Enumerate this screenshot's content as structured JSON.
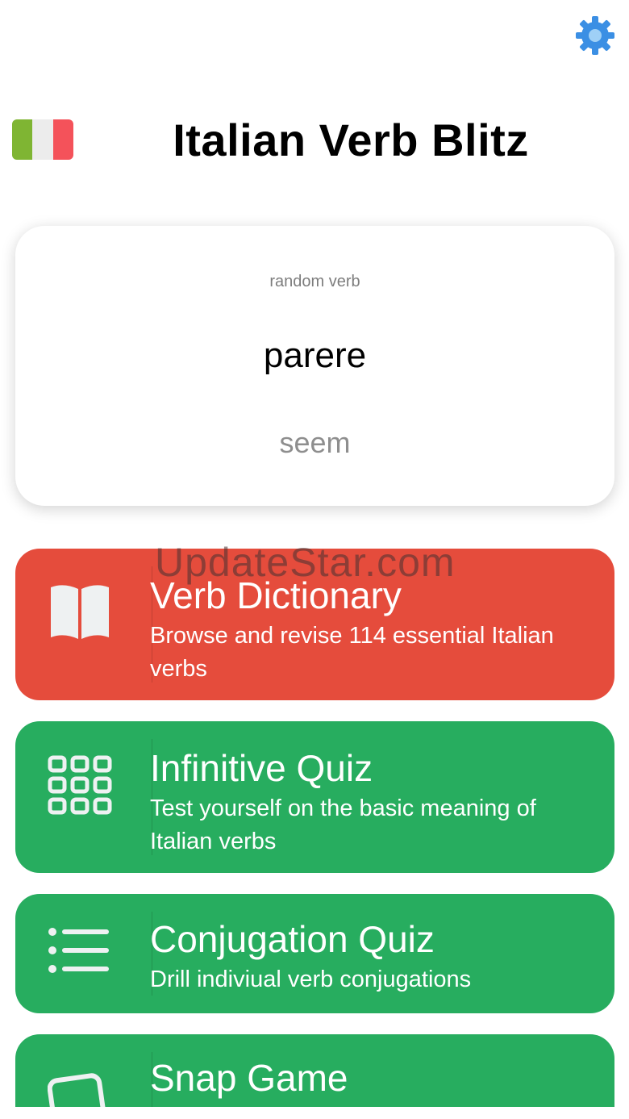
{
  "header": {
    "title": "Italian Verb Blitz",
    "flag_colors": [
      "#7fb533",
      "#ececec",
      "#f4525a"
    ],
    "settings_icon": "gear-icon"
  },
  "verb_card": {
    "label": "random verb",
    "verb": "parere",
    "translation": "seem"
  },
  "menu": {
    "items": [
      {
        "title": "Verb Dictionary",
        "description": "Browse and revise 114 essential Italian verbs",
        "icon": "book-icon",
        "color": "#e54c3c"
      },
      {
        "title": "Infinitive Quiz",
        "description": "Test yourself on the basic meaning of Italian verbs",
        "icon": "grid-icon",
        "color": "#27ad5f"
      },
      {
        "title": "Conjugation Quiz",
        "description": "Drill indiviual verb conjugations",
        "icon": "list-icon",
        "color": "#27ad5f"
      },
      {
        "title": "Snap Game",
        "description": "",
        "icon": "cards-icon",
        "color": "#27ad5f"
      }
    ]
  },
  "watermark": "UpdateStar.com",
  "colors": {
    "accent_blue": "#3b8fe4",
    "red": "#e54c3c",
    "green": "#27ad5f"
  }
}
